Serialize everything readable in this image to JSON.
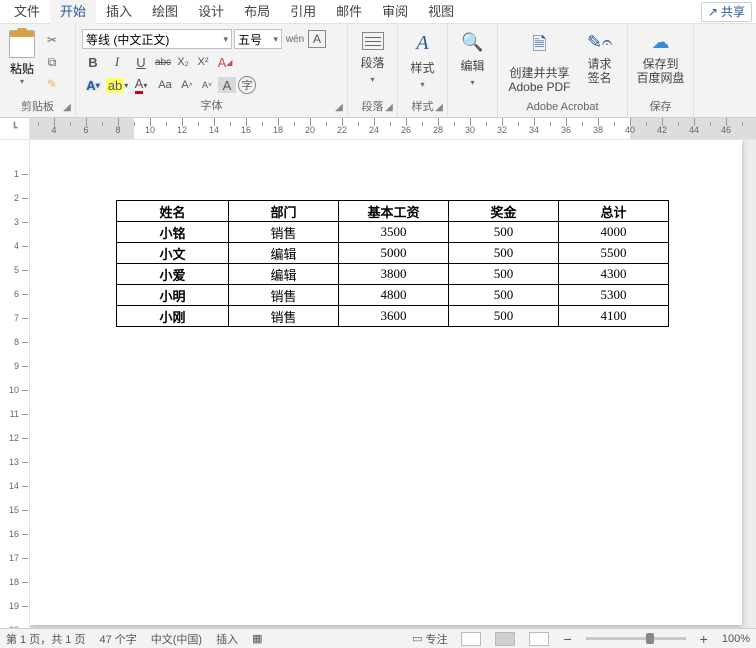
{
  "menu": {
    "file": "文件",
    "home": "开始",
    "insert": "插入",
    "draw": "绘图",
    "design": "设计",
    "layout": "布局",
    "references": "引用",
    "mailings": "邮件",
    "review": "审阅",
    "view": "视图"
  },
  "share": {
    "label": "共享"
  },
  "ribbon": {
    "clipboard": {
      "paste": "粘贴",
      "label": "剪贴板"
    },
    "font": {
      "name": "等线 (中文正文)",
      "size": "五号",
      "pinyin": "wén",
      "bordered": "A",
      "label": "字体",
      "btns": {
        "bold": "B",
        "italic": "I",
        "underline": "U",
        "strike": "abc",
        "sub": "X₂",
        "sup": "X²",
        "clear": "A",
        "textfx": "A",
        "highlight": "ab",
        "color": "A",
        "charcase": "Aa",
        "grow": "A˄",
        "shrink": "A˅",
        "charshade": "A",
        "enclose": "字"
      }
    },
    "paragraph": {
      "label": "段落",
      "btn": "段落",
      "icon": "≡"
    },
    "styles": {
      "label": "样式",
      "btn": "样式",
      "aglyph": "A"
    },
    "editing": {
      "label": "",
      "btn": "编辑"
    },
    "acrobat": {
      "label": "Adobe Acrobat",
      "create": "创建并共享\nAdobe PDF",
      "sign": "请求\n签名"
    },
    "baidu": {
      "label": "保存",
      "btn": "保存到\n百度网盘"
    }
  },
  "ruler": {
    "start": 2,
    "end": 46,
    "left_margin_end": 9,
    "right_margin_start": 40
  },
  "table": {
    "headers": [
      "姓名",
      "部门",
      "基本工资",
      "奖金",
      "总计"
    ],
    "rows": [
      {
        "name": "小铭",
        "dept": "销售",
        "base": "3500",
        "bonus": "500",
        "total": "4000"
      },
      {
        "name": "小文",
        "dept": "编辑",
        "base": "5000",
        "bonus": "500",
        "total": "5500"
      },
      {
        "name": "小爱",
        "dept": "编辑",
        "base": "3800",
        "bonus": "500",
        "total": "4300"
      },
      {
        "name": "小明",
        "dept": "销售",
        "base": "4800",
        "bonus": "500",
        "total": "5300"
      },
      {
        "name": "小刚",
        "dept": "销售",
        "base": "3600",
        "bonus": "500",
        "total": "4100"
      }
    ]
  },
  "status": {
    "page": "第 1 页，共 1 页",
    "words": "47 个字",
    "lang": "中文(中国)",
    "mode": "插入",
    "track": "专注",
    "zoom": "100%"
  },
  "zoom": {
    "minus": "−",
    "plus": "+",
    "pos": 60
  }
}
